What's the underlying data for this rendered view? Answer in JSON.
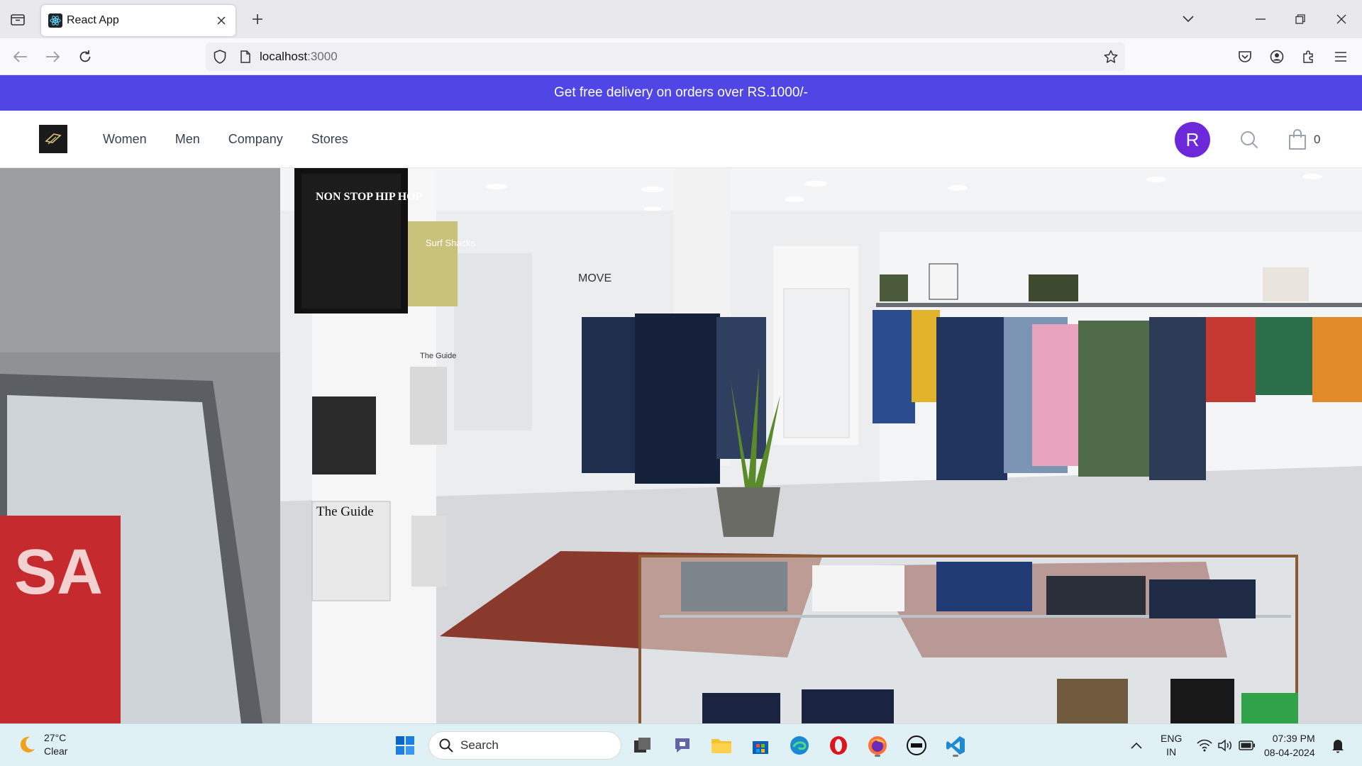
{
  "browser": {
    "tab_title": "React App",
    "url_host": "localhost",
    "url_port": ":3000"
  },
  "promo": {
    "text": "Get free delivery on orders over RS.1000/-"
  },
  "header": {
    "nav": [
      "Women",
      "Men",
      "Company",
      "Stores"
    ],
    "avatar_initial": "R",
    "cart_count": "0"
  },
  "hero": {
    "signs": [
      "NON STOP HIP HOP",
      "Surf Shacks",
      "The Guide",
      "The Guide",
      "MOVE",
      "SA"
    ]
  },
  "taskbar": {
    "weather_temp": "27°C",
    "weather_cond": "Clear",
    "search_label": "Search",
    "lang_1": "ENG",
    "lang_2": "IN",
    "time": "07:39 PM",
    "date": "08-04-2024"
  },
  "colors": {
    "promo_bg": "#4f46e5",
    "avatar_bg": "#6d28d9",
    "taskbar_bg": "#dff1f5"
  }
}
